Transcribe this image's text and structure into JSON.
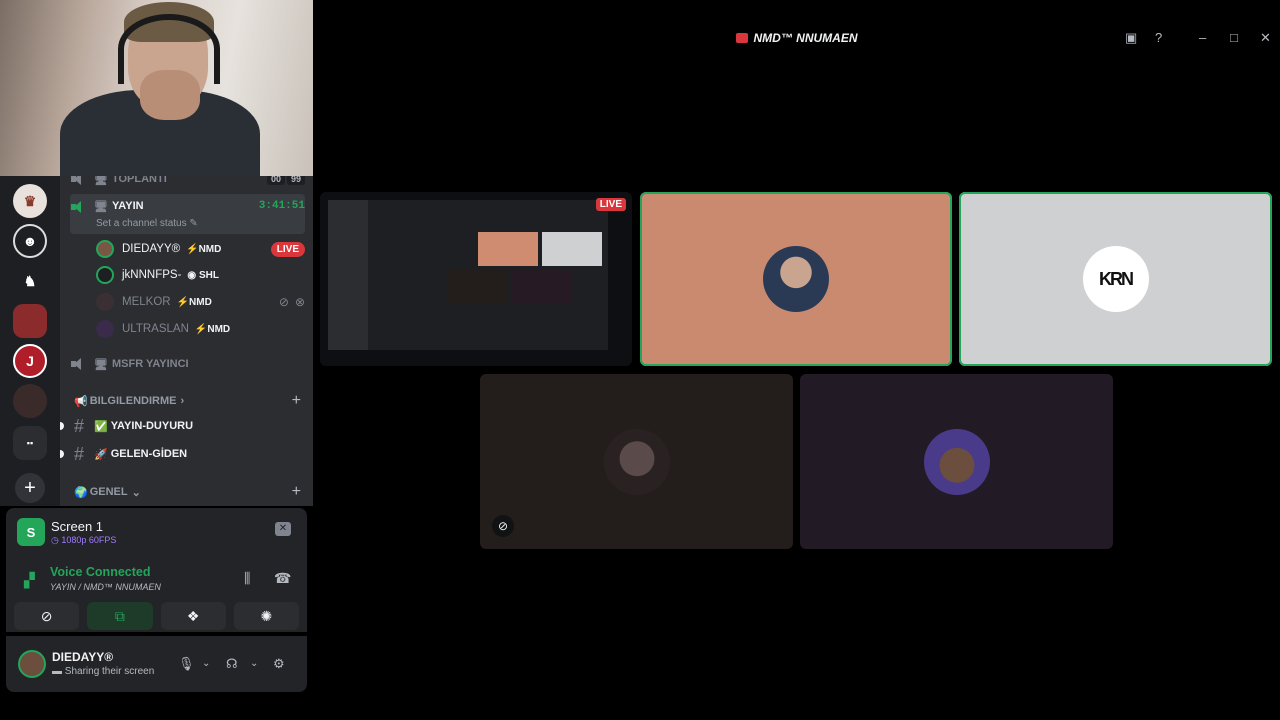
{
  "window": {
    "title": "NMD™ NNUMAEN"
  },
  "channels": {
    "toplanti": {
      "name": "TOPLANTI",
      "counter_a": "00",
      "counter_b": "99"
    },
    "yayin": {
      "name": "YAYIN",
      "time": "3:41:51",
      "status_placeholder": "Set a channel status",
      "users": [
        {
          "name": "DIEDAYY®",
          "tag": "NMD",
          "live": "LIVE"
        },
        {
          "name": "jkNNNFPS-",
          "tag": "SHL"
        },
        {
          "name": "MELKOR",
          "tag": "NMD"
        },
        {
          "name": "ULTRASLAN",
          "tag": "NMD"
        }
      ]
    },
    "msfr": {
      "name": "MSFR YAYINCI"
    },
    "categories": [
      {
        "name": "BILGILENDIRME",
        "emoji": "📢"
      },
      {
        "name": "GENEL",
        "emoji": "🌍"
      }
    ],
    "text_channels": [
      {
        "name": "YAYIN-DUYURU",
        "emoji": "✅"
      },
      {
        "name": "GELEN-GİDEN",
        "emoji": "🚀"
      }
    ]
  },
  "screen_share": {
    "title": "Screen 1",
    "quality": "1080p 60FPS"
  },
  "voice": {
    "status": "Voice Connected",
    "location": "YAYIN / NMD™ NNUMAEN"
  },
  "user": {
    "name": "DIEDAYY®",
    "status": "Sharing their screen"
  },
  "stage": {
    "live_label": "LIVE",
    "krn_text": "KRN"
  },
  "colors": {
    "accent_green": "#23a55a",
    "live_red": "#da373c",
    "nitro_purple": "#a07cff"
  }
}
